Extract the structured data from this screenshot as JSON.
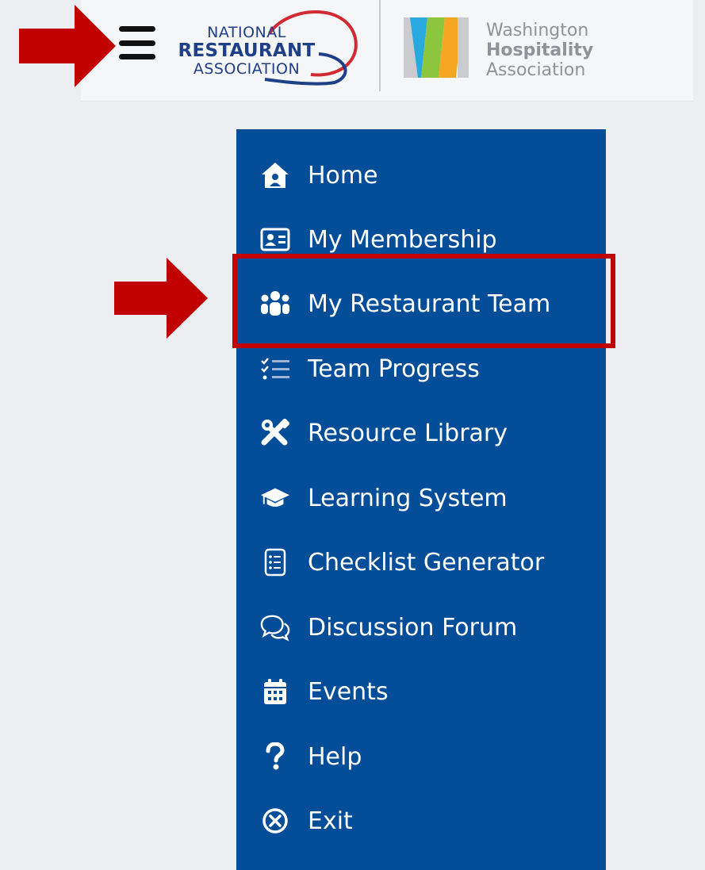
{
  "header": {
    "menu_button": "hamburger-menu",
    "nra_logo": {
      "line1": "NATIONAL",
      "line2": "RESTAURANT",
      "line3": "ASSOCIATION"
    },
    "wha_logo": {
      "line1": "Washington",
      "line2": "Hospitality",
      "line3": "Association"
    }
  },
  "menu": {
    "items": [
      {
        "label": "Home",
        "icon": "home-icon"
      },
      {
        "label": "My Membership",
        "icon": "id-card-icon"
      },
      {
        "label": "My Restaurant Team",
        "icon": "team-icon"
      },
      {
        "label": "Team Progress",
        "icon": "tasks-list-icon"
      },
      {
        "label": "Resource Library",
        "icon": "tools-icon"
      },
      {
        "label": "Learning System",
        "icon": "graduation-cap-icon"
      },
      {
        "label": "Checklist Generator",
        "icon": "checklist-icon"
      },
      {
        "label": "Discussion Forum",
        "icon": "chat-bubbles-icon"
      },
      {
        "label": "Events",
        "icon": "calendar-icon"
      },
      {
        "label": "Help",
        "icon": "question-icon"
      },
      {
        "label": "Exit",
        "icon": "close-circle-icon"
      }
    ]
  },
  "colors": {
    "menu_background": "#034d99",
    "header_background": "#f5f6f8",
    "annotation_red": "#c10000",
    "nra_blue": "#1f3f87"
  }
}
